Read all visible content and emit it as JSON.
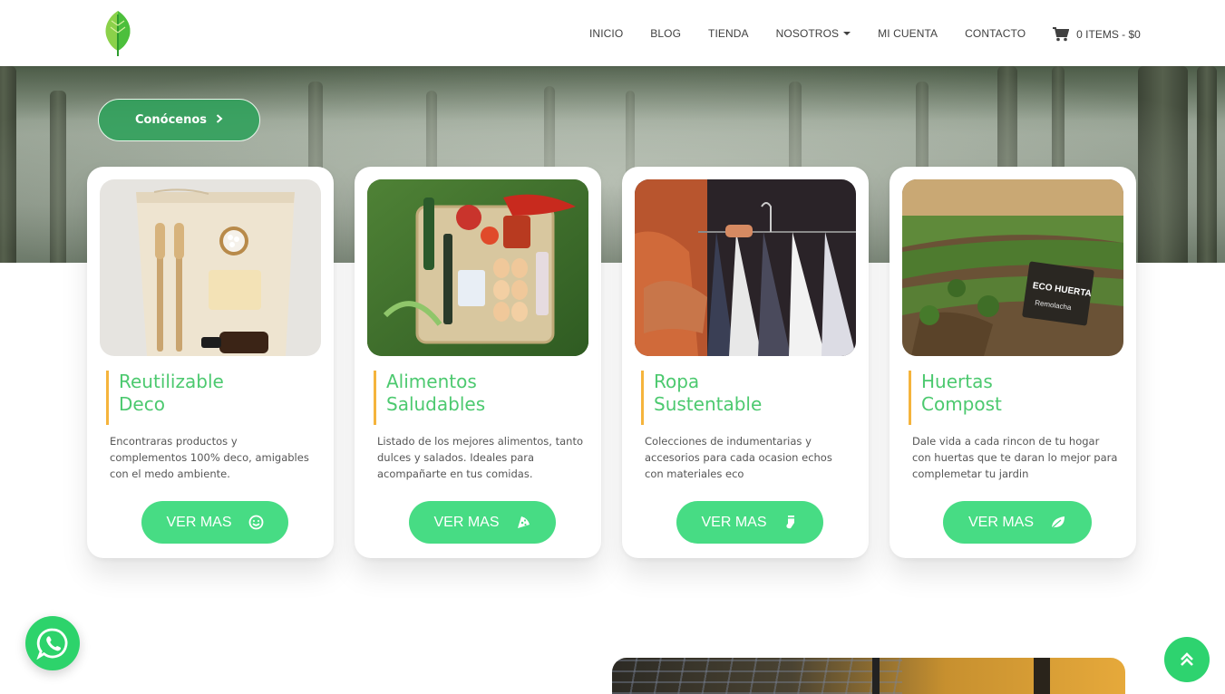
{
  "nav": {
    "items": [
      "INICIO",
      "BLOG",
      "TIENDA",
      "NOSOTROS",
      "MI CUENTA",
      "CONTACTO"
    ],
    "cart_label": "0 ITEMS - $0"
  },
  "hero": {
    "cta_label": "Conócenos"
  },
  "cards": [
    {
      "title_line1": "Reutilizable",
      "title_line2": "Deco",
      "description": "Encontraras productos y complementos 100% deco, amigables con el medo ambiente.",
      "button_label": "VER MAS",
      "button_icon": "smile-icon"
    },
    {
      "title_line1": "Alimentos",
      "title_line2": "Saludables",
      "description": "Listado de los mejores alimentos, tanto dulces y salados. Ideales para acompañarte en tus comidas.",
      "button_label": "VER MAS",
      "button_icon": "pizza-slice-icon"
    },
    {
      "title_line1": "Ropa",
      "title_line2": "Sustentable",
      "description": "Colecciones de indumentarias y accesorios para cada ocasion echos con materiales eco",
      "button_label": "VER MAS",
      "button_icon": "sock-icon"
    },
    {
      "title_line1": "Huertas",
      "title_line2": "Compost",
      "description": "Dale vida a cada rincon de tu hogar con huertas que te daran lo mejor para complemetar tu jardin",
      "button_label": "VER MAS",
      "button_icon": "leaf-icon"
    }
  ],
  "image_texts": {
    "eco_huerta_sign": "ECO HUERTA",
    "eco_huerta_sub": "Remolacha"
  },
  "colors": {
    "accent_green": "#47dc84",
    "title_green": "#4cc96f",
    "title_border": "#f5b43c",
    "whatsapp_green": "#2dd36b"
  }
}
